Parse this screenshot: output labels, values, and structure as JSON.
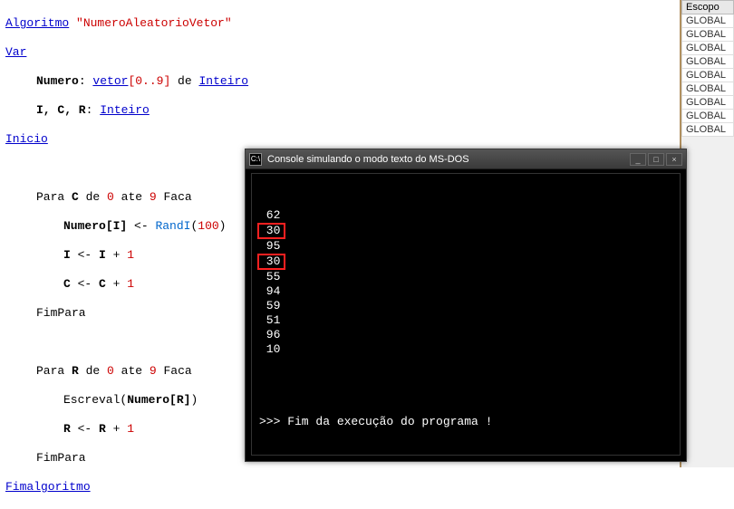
{
  "editor": {
    "l1_algoritmo": "Algoritmo",
    "l1_name": "\"NumeroAleatorioVetor\"",
    "l2_var": "Var",
    "l3_numero": "Numero",
    "l3_colon": ": ",
    "l3_vetor": "vetor",
    "l3_range": "[0..9]",
    "l3_de": " de ",
    "l3_inteiro": "Inteiro",
    "l4_vars": "I, C, R",
    "l4_colon": ": ",
    "l4_inteiro": "Inteiro",
    "l5_inicio": "Inicio",
    "l6_para": "Para ",
    "l6_c": "C",
    "l6_de": " de ",
    "l6_zero": "0",
    "l6_ate": " ate ",
    "l6_nine": "9",
    "l6_faca": " Faca",
    "l7_numero": "Numero",
    "l7_idx": "[I]",
    "l7_assign": " <- ",
    "l7_randi": "RandI",
    "l7_open": "(",
    "l7_hundred": "100",
    "l7_close": ")",
    "l8_i": "I",
    "l8_assign": " <- ",
    "l8_i2": "I",
    "l8_plus": " + ",
    "l8_one": "1",
    "l9_c": "C",
    "l9_assign": " <- ",
    "l9_c2": "C",
    "l9_plus": " + ",
    "l9_one": "1",
    "l10_fim": "FimPara",
    "l11_para": "Para ",
    "l11_r": "R",
    "l11_de": " de ",
    "l11_zero": "0",
    "l11_ate": " ate ",
    "l11_nine": "9",
    "l11_faca": " Faca",
    "l12_escreval": "Escreval",
    "l12_open": "(",
    "l12_numero": "Numero",
    "l12_idx": "[R]",
    "l12_close": ")",
    "l13_r": "R",
    "l13_assign": " <- ",
    "l13_r2": "R",
    "l13_plus": " + ",
    "l13_one": "1",
    "l14_fim": "FimPara",
    "l15_fim": "Fimalgoritmo"
  },
  "side": {
    "header": "Escopo",
    "rows": [
      "GLOBAL",
      "GLOBAL",
      "GLOBAL",
      "GLOBAL",
      "GLOBAL",
      "GLOBAL",
      "GLOBAL",
      "GLOBAL",
      "GLOBAL"
    ]
  },
  "console": {
    "title": "Console simulando o modo texto do MS-DOS",
    "icon": "C:\\",
    "output": [
      {
        "text": " 62",
        "hl": false
      },
      {
        "text": " 30",
        "hl": true
      },
      {
        "text": " 95",
        "hl": false
      },
      {
        "text": " 30",
        "hl": true
      },
      {
        "text": " 55",
        "hl": false
      },
      {
        "text": " 94",
        "hl": false
      },
      {
        "text": " 59",
        "hl": false
      },
      {
        "text": " 51",
        "hl": false
      },
      {
        "text": " 96",
        "hl": false
      },
      {
        "text": " 10",
        "hl": false
      }
    ],
    "end_message": ">>> Fim da execução do programa !",
    "btn_min": "_",
    "btn_max": "□",
    "btn_close": "×"
  }
}
